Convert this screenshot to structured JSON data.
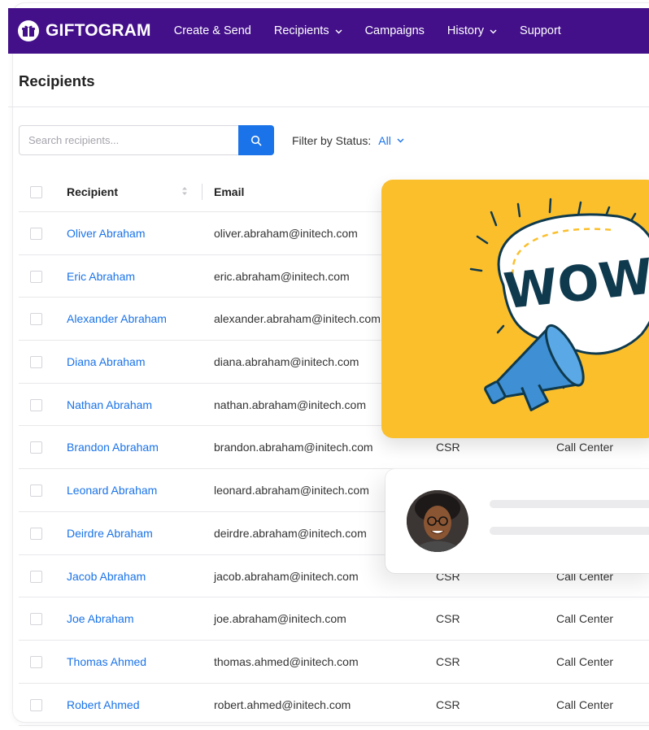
{
  "nav": {
    "logo_text": "GIFTOGRAM",
    "items": [
      {
        "label": "Create & Send",
        "dropdown": false
      },
      {
        "label": "Recipients",
        "dropdown": true
      },
      {
        "label": "Campaigns",
        "dropdown": false
      },
      {
        "label": "History",
        "dropdown": true
      },
      {
        "label": "Support",
        "dropdown": false
      }
    ]
  },
  "page": {
    "title": "Recipients"
  },
  "search": {
    "placeholder": "Search recipients..."
  },
  "filter": {
    "label": "Filter by Status:",
    "value": "All"
  },
  "table": {
    "headers": {
      "recipient": "Recipient",
      "email": "Email"
    },
    "rows": [
      {
        "name": "Oliver Abraham",
        "email": "oliver.abraham@initech.com",
        "role": "",
        "dept": ""
      },
      {
        "name": "Eric Abraham",
        "email": "eric.abraham@initech.com",
        "role": "",
        "dept": ""
      },
      {
        "name": "Alexander Abraham",
        "email": "alexander.abraham@initech.com",
        "role": "",
        "dept": ""
      },
      {
        "name": "Diana Abraham",
        "email": "diana.abraham@initech.com",
        "role": "",
        "dept": ""
      },
      {
        "name": "Nathan Abraham",
        "email": "nathan.abraham@initech.com",
        "role": "",
        "dept": ""
      },
      {
        "name": "Brandon Abraham",
        "email": "brandon.abraham@initech.com",
        "role": "CSR",
        "dept": "Call Center"
      },
      {
        "name": "Leonard Abraham",
        "email": "leonard.abraham@initech.com",
        "role": "",
        "dept": ""
      },
      {
        "name": "Deirdre Abraham",
        "email": "deirdre.abraham@initech.com",
        "role": "",
        "dept": ""
      },
      {
        "name": "Jacob Abraham",
        "email": "jacob.abraham@initech.com",
        "role": "CSR",
        "dept": "Call Center"
      },
      {
        "name": "Joe Abraham",
        "email": "joe.abraham@initech.com",
        "role": "CSR",
        "dept": "Call Center"
      },
      {
        "name": "Thomas Ahmed",
        "email": "thomas.ahmed@initech.com",
        "role": "CSR",
        "dept": "Call Center"
      },
      {
        "name": "Robert Ahmed",
        "email": "robert.ahmed@initech.com",
        "role": "CSR",
        "dept": "Call Center"
      }
    ]
  },
  "promo": {
    "wow_text": "WOW!"
  },
  "colors": {
    "nav_bg": "#43108a",
    "accent": "#1a73e8",
    "card_yellow": "#fbbf2c"
  }
}
